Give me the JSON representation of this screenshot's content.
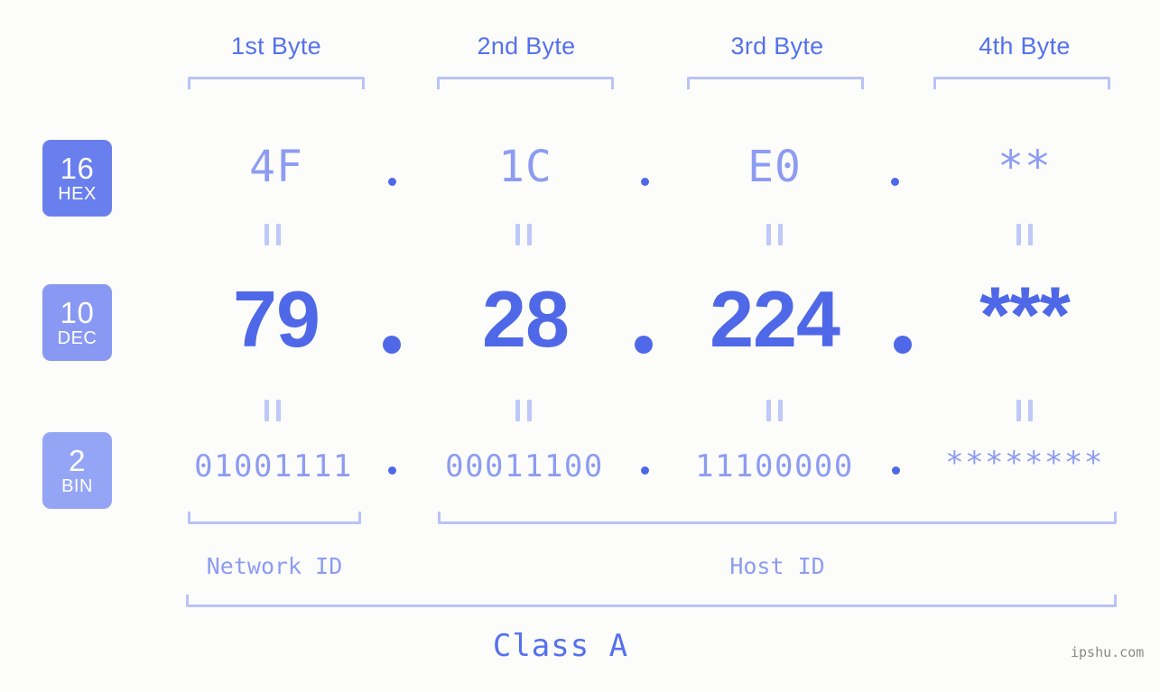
{
  "meta": {
    "background_color": "#fcfdfa",
    "accent_strong": "#4f68e8",
    "accent_mid": "#5570ee",
    "accent_light": "#8d9cf2",
    "bracket_color": "#b9c3f7",
    "watermark": "ipshu.com"
  },
  "byte_headers": [
    {
      "label": "1st Byte"
    },
    {
      "label": "2nd Byte"
    },
    {
      "label": "3rd Byte"
    },
    {
      "label": "4th Byte"
    }
  ],
  "bases": [
    {
      "number": "16",
      "name": "HEX",
      "color": "#6a7fee"
    },
    {
      "number": "10",
      "name": "DEC",
      "color": "#8998f2"
    },
    {
      "number": "2",
      "name": "BIN",
      "color": "#95a5f5"
    }
  ],
  "rows": {
    "hex": {
      "base_number": "16",
      "base_name": "HEX",
      "values": [
        "4F",
        "1C",
        "E0",
        "**"
      ],
      "separator": "."
    },
    "dec": {
      "base_number": "10",
      "base_name": "DEC",
      "values": [
        "79",
        "28",
        "224",
        "***"
      ],
      "separator": "."
    },
    "bin": {
      "base_number": "2",
      "base_name": "BIN",
      "values": [
        "01001111",
        "00011100",
        "11100000",
        "********"
      ],
      "separator": "."
    }
  },
  "equality_marks": {
    "glyph": "=",
    "count_per_gap": 4
  },
  "partitions": [
    {
      "name": "network-id",
      "label": "Network ID"
    },
    {
      "name": "host-id",
      "label": "Host ID"
    }
  ],
  "class": {
    "label": "Class A"
  }
}
